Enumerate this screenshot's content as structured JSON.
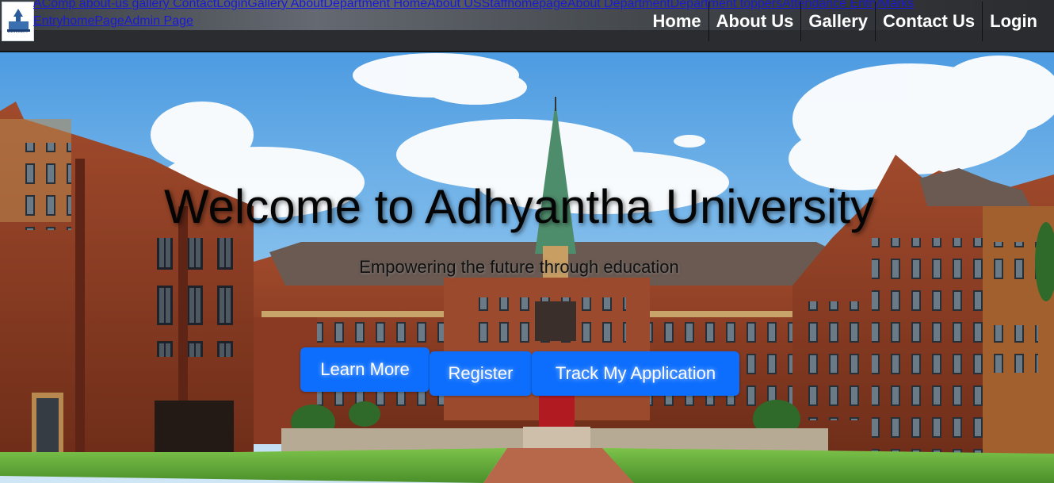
{
  "header": {
    "logo_text": "UNIVERSITY",
    "stray_links": [
      "index.php",
      "about-us",
      "gallery",
      "Contact",
      "Login",
      "Gallery",
      "About",
      "Department",
      "Home",
      "About US",
      "Staffhomepage",
      "About Department",
      "Department toppers",
      "Attendance Entry",
      "Marks Entry",
      "homePage",
      "Admin Page"
    ],
    "stray_line1": "AComp about-us gallery ContactLoginGallery AboutDepartment HomeAbout USStaffhomepageAbout DepartmentDepartment toppersAttendance EntryMarks",
    "stray_line2": "EntryhomePageAdmin Page",
    "nav": {
      "home": "Home",
      "about": "About Us",
      "gallery": "Gallery",
      "contact": "Contact Us",
      "login": "Login"
    }
  },
  "hero": {
    "title": "Welcome to Adhyantha University",
    "subtitle": "Empowering the future through education",
    "buttons": {
      "learn_more": "Learn More",
      "register": "Register",
      "track": "Track My Application"
    }
  },
  "colors": {
    "nav_bg": "#2b2c2f",
    "button_blue": "#0d6efd",
    "brick": "#8e3b24",
    "sky": "#6fb4ea",
    "lawn": "#5aa63a"
  }
}
